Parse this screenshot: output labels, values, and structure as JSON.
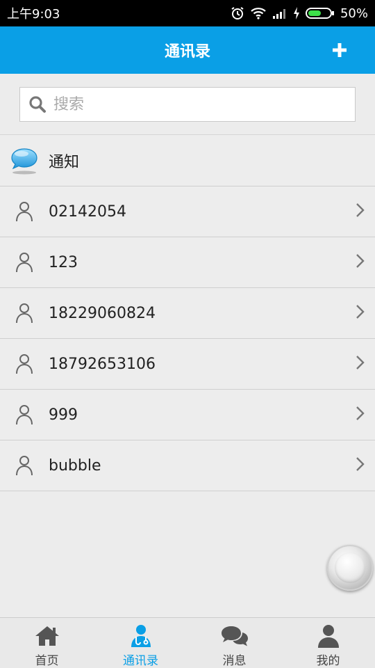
{
  "status_bar": {
    "time": "上午9:03",
    "battery": "50%"
  },
  "header": {
    "title": "通讯录",
    "add_icon": "plus-icon"
  },
  "search": {
    "placeholder": "搜索",
    "value": ""
  },
  "notice": {
    "label": "通知",
    "icon": "chat-bubble-icon"
  },
  "contacts": [
    {
      "name": "02142054"
    },
    {
      "name": "123"
    },
    {
      "name": "18229060824"
    },
    {
      "name": "18792653106"
    },
    {
      "name": "999"
    },
    {
      "name": "bubble"
    }
  ],
  "bottom_nav": {
    "items": [
      {
        "label": "首页",
        "icon": "home-icon"
      },
      {
        "label": "通讯录",
        "icon": "contacts-doctor-icon"
      },
      {
        "label": "消息",
        "icon": "messages-icon"
      },
      {
        "label": "我的",
        "icon": "profile-icon"
      }
    ],
    "active_index": 1
  },
  "colors": {
    "accent": "#0a9fe6",
    "background": "#ececec"
  }
}
